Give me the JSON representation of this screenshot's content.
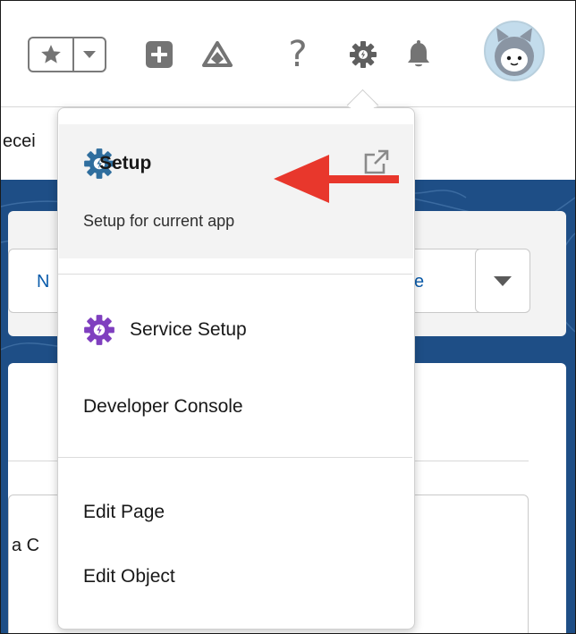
{
  "header": {
    "favorites_star_icon": "star-icon",
    "favorites_dropdown_icon": "chevron-down-icon",
    "global_actions_icon": "plus-icon",
    "guidance_center_icon": "trailhead-icon",
    "help_icon": "question-mark-icon",
    "setup_gear_icon": "gear-icon",
    "notifications_icon": "bell-icon",
    "avatar_icon": "user-avatar-icon"
  },
  "background": {
    "subbar_partial_text": "ecei",
    "card_button_left_partial": "N",
    "card_button_right_partial": "se",
    "card_lower_partial_text": "a C"
  },
  "setup_menu": {
    "setup_label": "Setup",
    "setup_description": "Setup for current app",
    "service_setup_label": "Service Setup",
    "developer_console_label": "Developer Console",
    "edit_page_label": "Edit Page",
    "edit_object_label": "Edit Object"
  },
  "colors": {
    "setup_gear": "#2f6e9e",
    "service_setup_gear": "#7f3fbf",
    "annotation_arrow": "#e8372c",
    "header_icon_gray": "#747474",
    "link_blue": "#0b5cab",
    "background_band": "#1e4e86"
  }
}
